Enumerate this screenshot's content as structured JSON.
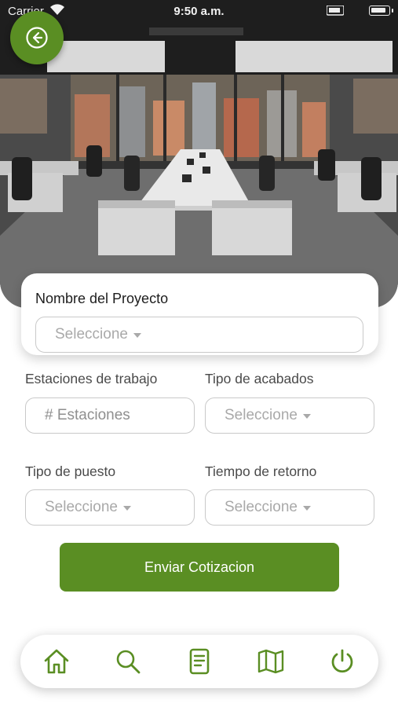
{
  "status_bar": {
    "carrier": "Carrier",
    "time": "9:50 a.m."
  },
  "header": {
    "back_icon": "arrow-left-circle-icon"
  },
  "project": {
    "label": "Nombre del Proyecto",
    "select_placeholder": "Seleccione"
  },
  "form": {
    "workstations": {
      "label": "Estaciones de trabajo",
      "placeholder": "# Estaciones"
    },
    "finish_type": {
      "label": "Tipo de acabados",
      "placeholder": "Seleccione"
    },
    "post_type": {
      "label": "Tipo de puesto",
      "placeholder": "Seleccione"
    },
    "return_time": {
      "label": "Tiempo de retorno",
      "placeholder": "Seleccione"
    }
  },
  "submit": {
    "label": "Enviar Cotizacion"
  },
  "tab_bar": {
    "items": [
      {
        "icon": "home-icon"
      },
      {
        "icon": "search-icon"
      },
      {
        "icon": "document-icon"
      },
      {
        "icon": "map-icon"
      },
      {
        "icon": "power-icon"
      }
    ]
  },
  "colors": {
    "accent": "#5a8e23",
    "placeholder": "#a9a9a9",
    "border": "#c9c9c9"
  }
}
